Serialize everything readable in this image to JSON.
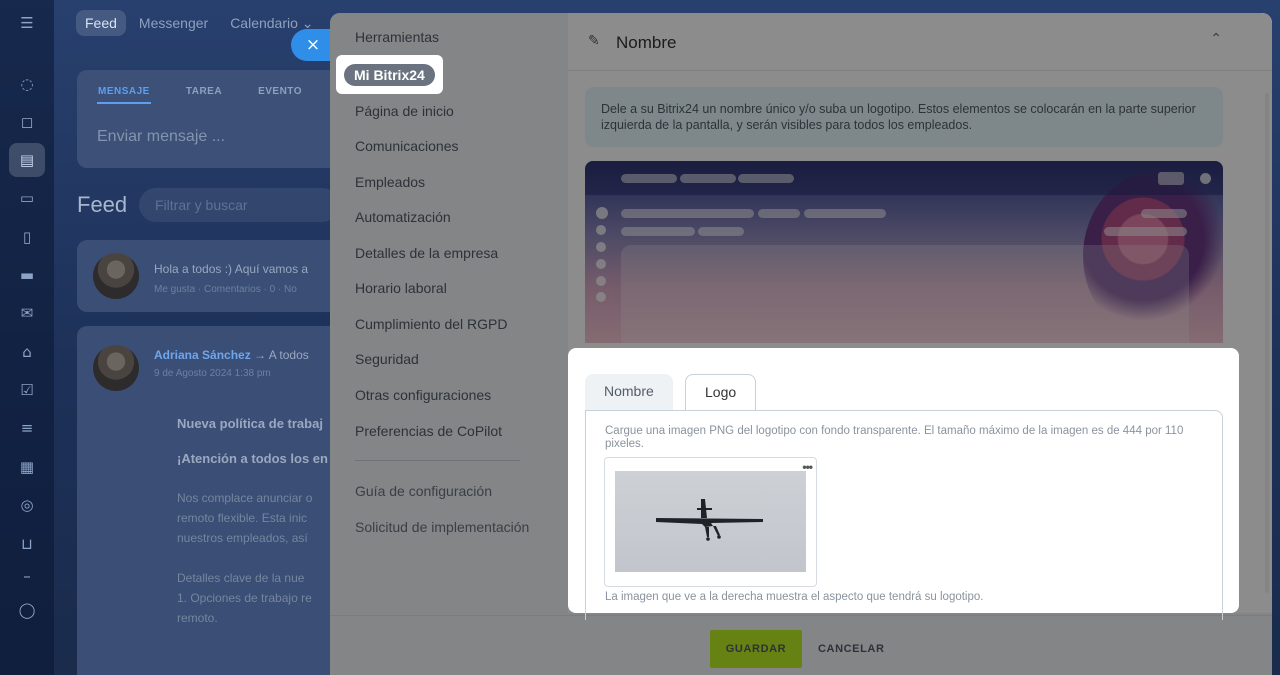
{
  "background": {
    "nav_tabs": [
      "Feed",
      "Messenger",
      "Calendario ⌄"
    ],
    "composer_tabs": [
      "MENSAJE",
      "TAREA",
      "EVENTO"
    ],
    "composer_placeholder": "Enviar mensaje ...",
    "feed_title": "Feed",
    "feed_filter": "Filtrar y buscar",
    "post1": {
      "text": "Hola a todos :) Aquí vamos a",
      "meta": "Me gusta · Comentarios · 0 · No"
    },
    "post2": {
      "author": "Adriana Sánchez",
      "to": "→ A todos",
      "date": "9 de Agosto 2024 1:38 pm",
      "headline": "Nueva política de trabaj",
      "alert": "¡Atención a todos los en",
      "body_lines": [
        "Nos complace anunciar o",
        "remoto flexible. Esta inic",
        "nuestros empleados, así"
      ],
      "details_lines": [
        "Detalles clave de la nue",
        "1. Opciones de trabajo re",
        "remoto."
      ]
    }
  },
  "slider": {
    "close_label": "×",
    "menu": {
      "items": [
        "Herramientas",
        "Mi Bitrix24",
        "Página de inicio",
        "Comunicaciones",
        "Empleados",
        "Automatización",
        "Detalles de la empresa",
        "Horario laboral",
        "Cumplimiento del RGPD",
        "Seguridad",
        "Otras configuraciones",
        "Preferencias de CoPilot"
      ],
      "secondary": [
        "Guía de configuración",
        "Solicitud de implementación"
      ]
    },
    "section": {
      "title": "Nombre",
      "info": "Dele a su Bitrix24 un nombre único y/o suba un logotipo. Estos elementos se colocarán en la parte superior izquierda de la pantalla, y serán visibles para todos los empleados."
    },
    "logo_card": {
      "tabs": [
        "Nombre",
        "Logo"
      ],
      "active_tab": "Logo",
      "upload_hint": "Cargue una imagen PNG del logotipo con fondo transparente. El tamaño máximo de la imagen es de 444 por 110 pixeles.",
      "menu_glyph": "•••",
      "preview_hint": "La imagen que ve a la derecha muestra el aspecto que tendrá su logotipo."
    },
    "footer": {
      "save": "GUARDAR",
      "cancel": "CANCELAR"
    }
  },
  "colors": {
    "save_button": "#bbed21",
    "info_box": "#e5f8fd",
    "accent_blue": "#2f8ee8",
    "highlight_pill": "#6a737f"
  },
  "icons": [
    "menu-icon",
    "pen-icon",
    "chevron-up-icon",
    "close-icon",
    "more-icon"
  ]
}
